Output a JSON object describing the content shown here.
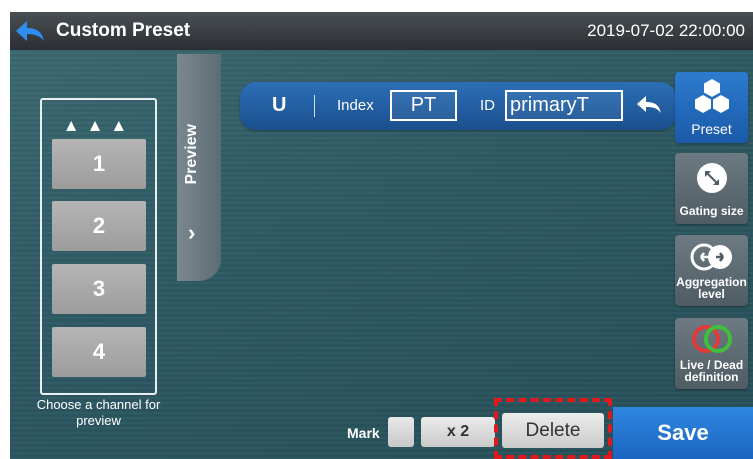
{
  "header": {
    "title": "Custom Preset",
    "datetime": "2019-07-02  22:00:00"
  },
  "channels": {
    "scroll_up": "▲▲▲",
    "items": [
      "1",
      "2",
      "3",
      "4"
    ],
    "hint": "Choose a channel for preview"
  },
  "preview": {
    "label": "Preview",
    "chevron": "›"
  },
  "preset_bar": {
    "unit": "U",
    "index_label": "Index",
    "index_value": "PT",
    "id_label": "ID",
    "id_value": "primaryT"
  },
  "side_buttons": [
    {
      "label": "Preset",
      "icon": "hexagon-cluster-icon",
      "active": true
    },
    {
      "label": "Gating size",
      "icon": "expand-circle-icon",
      "active": false
    },
    {
      "label": "Aggregation level",
      "icon": "aggregation-arrows-icon",
      "active": false
    },
    {
      "label": "Live / Dead definition",
      "icon": "red-green-rings-icon",
      "active": false
    }
  ],
  "bottom": {
    "mark_label": "Mark",
    "x2_label": "x 2",
    "delete_label": "Delete",
    "save_label": "Save"
  },
  "colors": {
    "accent_blue": "#1b66c2",
    "highlight_red": "#e0191e",
    "ring_red": "#e23a3a",
    "ring_green": "#3fbf3a"
  }
}
